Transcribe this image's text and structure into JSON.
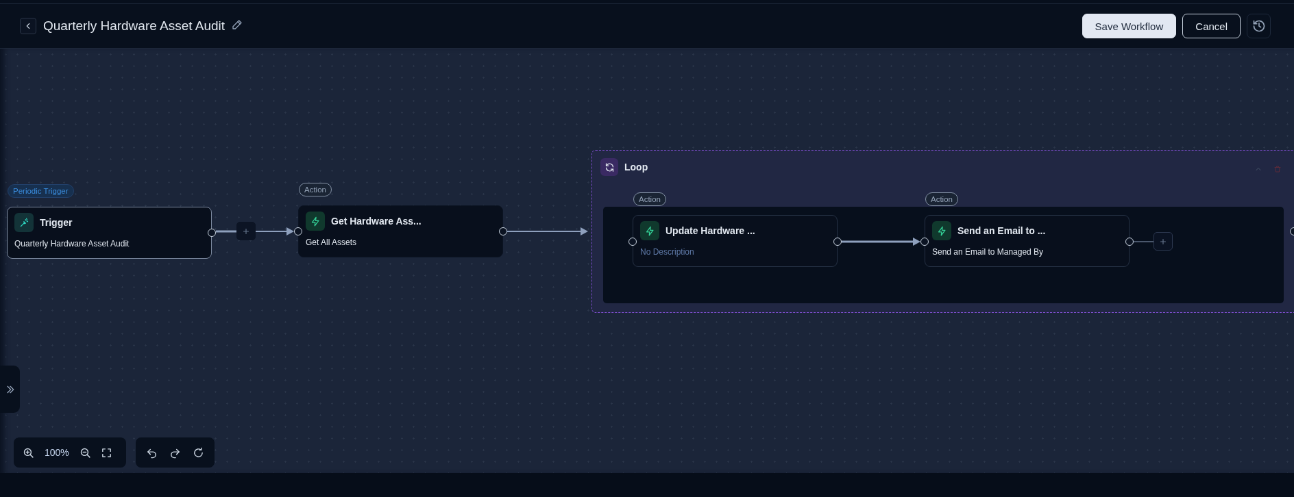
{
  "header": {
    "title": "Quarterly Hardware Asset Audit",
    "buttons": [
      {
        "label": "Save Workflow",
        "kind": "primary"
      },
      {
        "label": "Cancel",
        "kind": "secondary"
      }
    ]
  },
  "canvas": {
    "nodes": [
      {
        "kind": "trigger",
        "badge": "Periodic Trigger",
        "title": "Trigger",
        "description": "Quarterly Hardware Asset Audit",
        "placeholder": false
      },
      {
        "kind": "action",
        "badge": "Action",
        "title": "Get Hardware Ass...",
        "description": "Get All Assets",
        "placeholder": false
      }
    ],
    "loop": {
      "title": "Loop",
      "nodes": [
        {
          "kind": "action",
          "badge": "Action",
          "title": "Update Hardware ...",
          "description": "No Description",
          "placeholder": true
        },
        {
          "kind": "action",
          "badge": "Action",
          "title": "Send an Email to ...",
          "description": "Send an Email to Managed By",
          "placeholder": false
        }
      ]
    }
  },
  "zoom": {
    "reading": "100%"
  }
}
